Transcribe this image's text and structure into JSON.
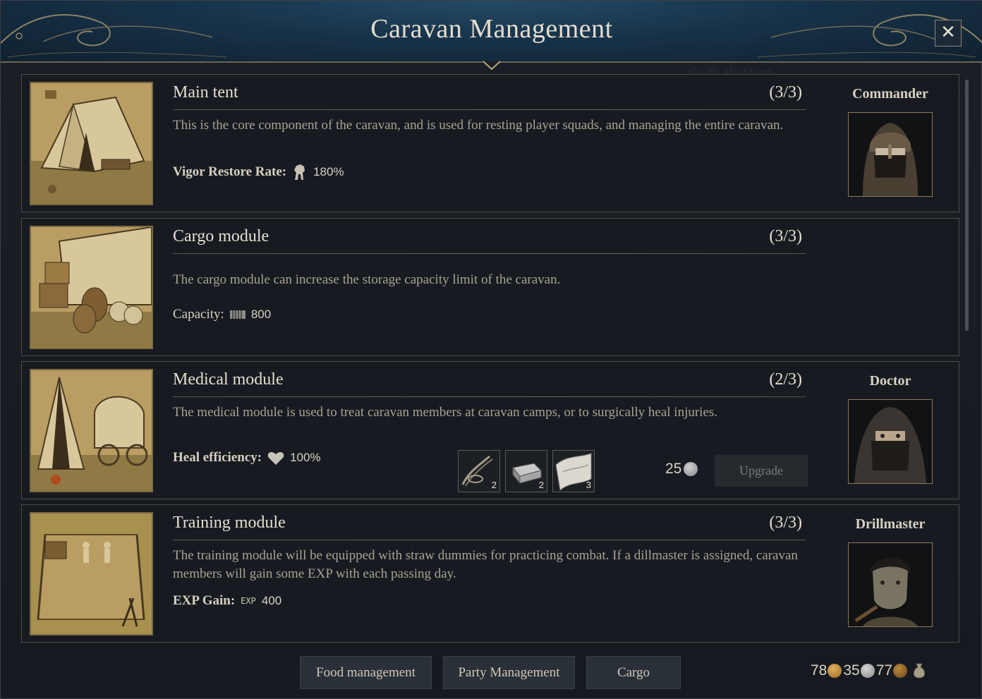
{
  "window": {
    "title": "Caravan Management",
    "close_label": "✕",
    "background_text": "Gridla Highland"
  },
  "modules": [
    {
      "name": "Main tent",
      "level": "(3/3)",
      "description": "This is the core component of the caravan, and is used for resting player squads, and managing the entire caravan.",
      "stat_label": "Vigor Restore Rate:",
      "stat_icon": "vigor-icon",
      "stat_value": "180%",
      "role": "Commander",
      "portrait": "commander-portrait"
    },
    {
      "name": "Cargo module",
      "level": "(3/3)",
      "description": "The cargo module can increase the storage capacity limit of the caravan.",
      "stat_label": "Capacity:",
      "stat_icon": "capacity-icon",
      "stat_value": "800"
    },
    {
      "name": "Medical module",
      "level": "(2/3)",
      "description": "The medical module is used to treat caravan members at caravan camps, or to surgically heal injuries.",
      "stat_label": "Heal efficiency:",
      "stat_icon": "heart-icon",
      "stat_value": "100%",
      "role": "Doctor",
      "portrait": "doctor-portrait",
      "upgrade": {
        "materials": [
          {
            "icon": "rope-icon",
            "count": "2"
          },
          {
            "icon": "iron-ingot-icon",
            "count": "2"
          },
          {
            "icon": "cloth-icon",
            "count": "3"
          }
        ],
        "cost": "25",
        "button_label": "Upgrade"
      }
    },
    {
      "name": "Training module",
      "level": "(3/3)",
      "description": "The training module will be equipped with straw dummies for practicing combat. If a dillmaster is assigned, caravan members will gain some EXP with each passing day.",
      "stat_label": "EXP Gain:",
      "stat_icon": "exp-icon",
      "stat_icon_text": "EXP",
      "stat_value": "400",
      "role": "Drillmaster",
      "portrait": "drillmaster-portrait"
    }
  ],
  "footer": {
    "buttons": [
      "Food management",
      "Party Management",
      "Cargo"
    ],
    "currency": {
      "gold": "78",
      "silver": "35",
      "copper": "77"
    }
  },
  "colors": {
    "gold": "#c9923a",
    "silver": "#a9a9a9",
    "copper": "#9a6a2c",
    "title": "#e3dccd"
  }
}
